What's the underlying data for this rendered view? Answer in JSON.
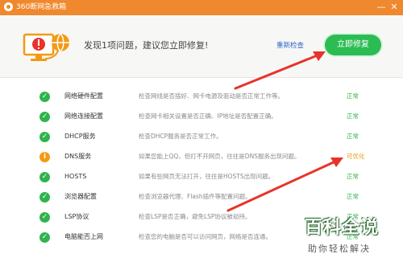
{
  "window": {
    "title": "360断网急救箱",
    "minimize_glyph": "—",
    "close_glyph": "✕"
  },
  "header": {
    "message": "发现1项问题，建议您立即修复!",
    "recheck_label": "重新检查",
    "fix_button_label": "立即修复"
  },
  "rows": [
    {
      "name": "网络硬件配置",
      "desc": "检查网线是否插好、网卡电源及驱动是否正常工作等。",
      "status": "正常",
      "state": "ok"
    },
    {
      "name": "网络连接配置",
      "desc": "检查网卡相关设置是否正确、IP地址是否配置正确。",
      "status": "正常",
      "state": "ok"
    },
    {
      "name": "DHCP服务",
      "desc": "检查DHCP服务是否正常工作。",
      "status": "正常",
      "state": "ok"
    },
    {
      "name": "DNS服务",
      "desc": "如果您能上QQ，但打不开网页，往往是DNS服务出现问题。",
      "status": "可优化",
      "state": "warn"
    },
    {
      "name": "HOSTS",
      "desc": "如果有些网页无法打开，往往是HOSTS出现问题。",
      "status": "正常",
      "state": "ok"
    },
    {
      "name": "浏览器配置",
      "desc": "检查浏览器代理、Flash插件等配置问题。",
      "status": "正常",
      "state": "ok"
    },
    {
      "name": "LSP协议",
      "desc": "检查LSP是否正确，避免LSP协议被劫持。",
      "status": "正常",
      "state": "ok"
    },
    {
      "name": "电脑能否上网",
      "desc": "检查您的电脑是否可以访问网页，网络是否连通。",
      "status": "正常",
      "state": "ok"
    }
  ],
  "icons": {
    "ok": "✓",
    "warn": "i"
  },
  "watermark": {
    "title": "百科全说",
    "subtitle": "助你轻松解决"
  },
  "colors": {
    "titlebar": "#f0882d",
    "fix_button": "#2bbd53",
    "ok": "#2fb44d",
    "warn": "#f29a14",
    "arrow": "#e8332a",
    "link": "#2f63c6"
  }
}
